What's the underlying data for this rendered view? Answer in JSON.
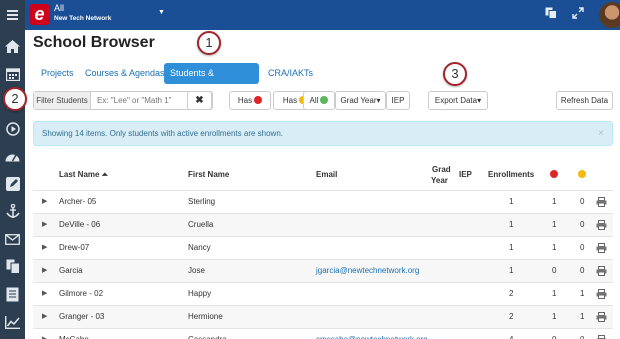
{
  "topbar": {
    "logo_letter": "e",
    "org_title": "All",
    "org_subtitle": "New Tech Network"
  },
  "sidebar": {
    "items": [
      "menu-icon",
      "home-icon",
      "calendar-icon",
      "comments-icon",
      "play-icon",
      "dashboard-icon",
      "edit-icon",
      "anchor-icon",
      "mail-icon",
      "copy-icon",
      "document-icon",
      "chart-icon"
    ]
  },
  "page": {
    "title": "School Browser"
  },
  "tabs": [
    {
      "label": "Projects",
      "active": false
    },
    {
      "label": "Courses & Agendas",
      "active": false
    },
    {
      "label": "Students & Enrollments",
      "active": true
    },
    {
      "label": "CRA/IAKTs",
      "active": false
    }
  ],
  "callouts": [
    "1",
    "2",
    "3"
  ],
  "filter": {
    "label": "Filter Students",
    "placeholder": "Ex: \"Lee\" or \"Math 1\"",
    "clear_label": "✖"
  },
  "filter_buttons": {
    "has_red": "Has",
    "has_yellow": "Has",
    "all_green": "All",
    "grad_year": "Grad Year▾",
    "iep": "IEP",
    "export": "Export Data▾",
    "refresh": "Refresh Data"
  },
  "banner": {
    "text": "Showing 14 items. Only students with active enrollments are shown.",
    "close": "×"
  },
  "table": {
    "headers": {
      "last_name": "Last Name ⏶",
      "first_name": "First Name",
      "email": "Email",
      "grad_year_1": "Grad",
      "grad_year_2": "Year",
      "iep": "IEP",
      "enrollments": "Enrollments"
    },
    "rows": [
      {
        "last": "Archer- 05",
        "first": "Sterling",
        "email": "",
        "enrollments": "1",
        "red": "1",
        "yellow": "0"
      },
      {
        "last": "DeVille - 06",
        "first": "Cruella",
        "email": "",
        "enrollments": "1",
        "red": "1",
        "yellow": "0"
      },
      {
        "last": "Drew-07",
        "first": "Nancy",
        "email": "",
        "enrollments": "1",
        "red": "1",
        "yellow": "0"
      },
      {
        "last": "Garcia",
        "first": "Jose",
        "email": "jgarcia@newtechnetwork.org",
        "enrollments": "1",
        "red": "0",
        "yellow": "0"
      },
      {
        "last": "Gilmore - 02",
        "first": "Happy",
        "email": "",
        "enrollments": "2",
        "red": "1",
        "yellow": "1"
      },
      {
        "last": "Granger - 03",
        "first": "Hermione",
        "email": "",
        "enrollments": "2",
        "red": "1",
        "yellow": "1"
      },
      {
        "last": "McCabe",
        "first": "Cassandra",
        "email": "cmccabe@newtechnetwork.org",
        "enrollments": "4",
        "red": "0",
        "yellow": "0"
      }
    ]
  },
  "colors": {
    "topbar": "#1b4f95",
    "sidebar": "#2c3e50",
    "accent": "#2f8fd8",
    "link": "#1a6fb5",
    "callout_ring": "#a3232a"
  }
}
